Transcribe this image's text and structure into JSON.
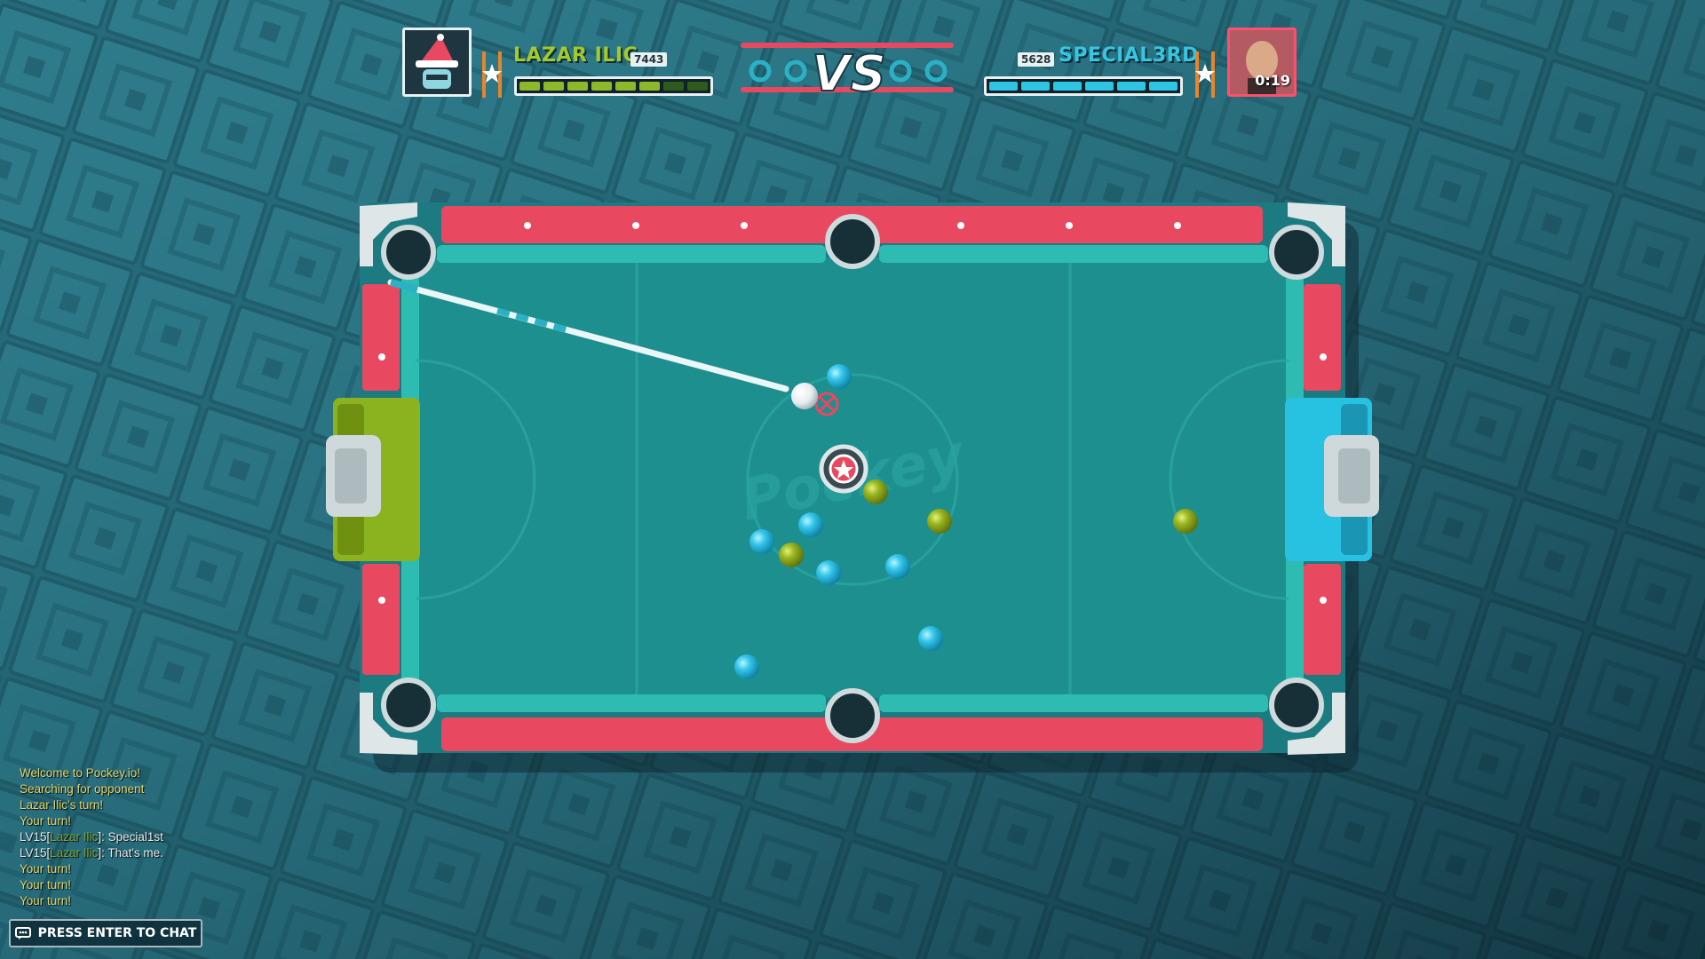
{
  "game": {
    "title": "Pockey.io",
    "table_logo": "Pockey"
  },
  "hud": {
    "player_left": {
      "name": "LAZAR ILIC",
      "score": "7443",
      "health_filled": 6,
      "health_total": 8,
      "avatar": "wizard-hat-avatar",
      "color": "#a5c82a"
    },
    "vs_label": "VS",
    "player_right": {
      "name": "SPECIAL3RD",
      "score": "5628",
      "health_filled": 6,
      "health_total": 6,
      "avatar": "photo-avatar",
      "turn_timer": "0:19",
      "color": "#36c6e2"
    },
    "rank_icon": "sheriff-star-icon"
  },
  "table": {
    "felt_color": "#1d8f8f",
    "rail_color": "#e84960",
    "goal_left_color": "#8bb21f",
    "goal_right_color": "#27c2e2"
  },
  "chat": {
    "messages": [
      {
        "text": "Welcome to Pockey.io!"
      },
      {
        "text": "Searching for opponent"
      },
      {
        "text": "Lazar Ilic's turn!"
      },
      {
        "text": "Your turn!"
      },
      {
        "prefix": "LV15[",
        "user": "Lazar Ilic",
        "suffix": "]: ",
        "text": "Special1st"
      },
      {
        "prefix": "LV15[",
        "user": "Lazar Ilic",
        "suffix": "]: ",
        "text": "That's me."
      },
      {
        "text": "Your turn!"
      },
      {
        "text": "Your turn!"
      },
      {
        "text": "Your turn!"
      }
    ],
    "press_enter_label": "PRESS ENTER TO CHAT",
    "chat_icon": "chat-bubble-icon"
  }
}
